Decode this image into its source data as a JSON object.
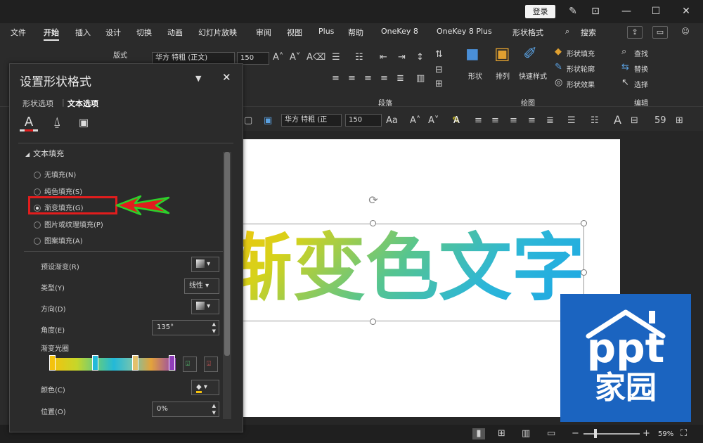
{
  "titlebar": {
    "login_label": "登录"
  },
  "menu": {
    "items": [
      "文件",
      "开始",
      "插入",
      "设计",
      "切换",
      "动画",
      "幻灯片放映",
      "审阅",
      "视图",
      "Plus",
      "帮助",
      "OneKey 8",
      "OneKey 8 Plus",
      "形状格式",
      "搜索"
    ],
    "active_index": 1
  },
  "ribbon": {
    "layout_label": "版式",
    "font_name": "华方 特粗 (正文)",
    "font_size": "150",
    "paragraph_group_label": "段落",
    "drawing_group_label": "绘图",
    "editing_group_label": "编辑",
    "shape_label": "形状",
    "arrange_label": "排列",
    "quick_style_label": "快速样式",
    "shape_fill_label": "形状填充",
    "shape_outline_label": "形状轮廓",
    "shape_effect_label": "形状效果",
    "find_label": "查找",
    "replace_label": "替换",
    "select_label": "选择"
  },
  "fmtbar": {
    "font_name": "华方 特粗 (正",
    "font_size": "150"
  },
  "pane": {
    "title": "设置形状格式",
    "tabs": [
      "形状选项",
      "文本选项"
    ],
    "active_tab_index": 1,
    "section_title": "文本填充",
    "fill_options": [
      "无填充(N)",
      "纯色填充(S)",
      "渐变填充(G)",
      "图片或纹理填充(P)",
      "图案填充(A)"
    ],
    "selected_fill_index": 2,
    "preset_label": "预设渐变(R)",
    "type_label": "类型(Y)",
    "type_value": "线性",
    "direction_label": "方向(D)",
    "angle_label": "角度(E)",
    "angle_value": "135°",
    "stops_label": "渐变光圈",
    "color_label": "颜色(C)",
    "position_label": "位置(O)",
    "position_value": "0%"
  },
  "slide": {
    "text": "渐变色文字"
  },
  "logo": {
    "line1": "ppt",
    "line2": "家园"
  },
  "status": {
    "zoom": "59%"
  },
  "colors": {
    "accent_red": "#e11d1d",
    "arrow_green": "#2bd12b",
    "logo_blue": "#1b64c0"
  }
}
